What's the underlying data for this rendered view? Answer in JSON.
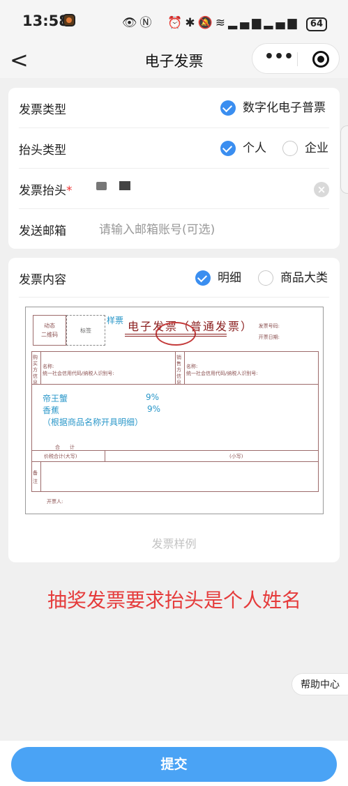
{
  "status_bar": {
    "time": "13:58",
    "battery": "64",
    "icons": [
      "eye-icon",
      "nfc-icon",
      "alarm-icon",
      "bluetooth-icon",
      "vibrate-icon",
      "mute-icon",
      "wifi-icon",
      "signal-icon",
      "4g-signal-icon"
    ]
  },
  "nav": {
    "back": "<",
    "title": "电子发票",
    "more": "•••"
  },
  "form": {
    "invoice_type": {
      "label": "发票类型",
      "option": "数字化电子普票"
    },
    "header_type": {
      "label": "抬头类型",
      "options": [
        "个人",
        "企业"
      ]
    },
    "invoice_header": {
      "label": "发票抬头",
      "required": "*",
      "clear": "×"
    },
    "email": {
      "label": "发送邮箱",
      "placeholder": "请输入邮箱账号(可选)",
      "value": ""
    }
  },
  "content": {
    "label": "发票内容",
    "options": [
      "明细",
      "商品大类"
    ],
    "caption": "发票样例",
    "sample": {
      "qr": [
        "动态",
        "二维码"
      ],
      "mark": "标签",
      "sample_tag": "样票",
      "title": "电子发票（普通发票）",
      "invoice_no": "发票号码:",
      "issue_date": "开票日期:",
      "buyer": "购买方信息",
      "seller": "销售方信息",
      "name": "名称:",
      "tax_id": "统一社会信用代码/纳税人识别号:",
      "items": [
        {
          "name": "帝王蟹",
          "rate": "9%"
        },
        {
          "name": "香蕉",
          "rate": "9%"
        }
      ],
      "note": "（根据商品名称开具明细）",
      "total": "合　　计",
      "total_tax": "价税合计(大写)",
      "small": "(小写)",
      "remark": "备注",
      "issuer": "开票人:"
    }
  },
  "notice": "抽奖发票要求抬头是个人姓名",
  "help": "帮助中心",
  "submit": "提交",
  "colors": {
    "accent": "#4aa3f5",
    "check": "#3a8ef0",
    "notice": "#e53b3b"
  }
}
